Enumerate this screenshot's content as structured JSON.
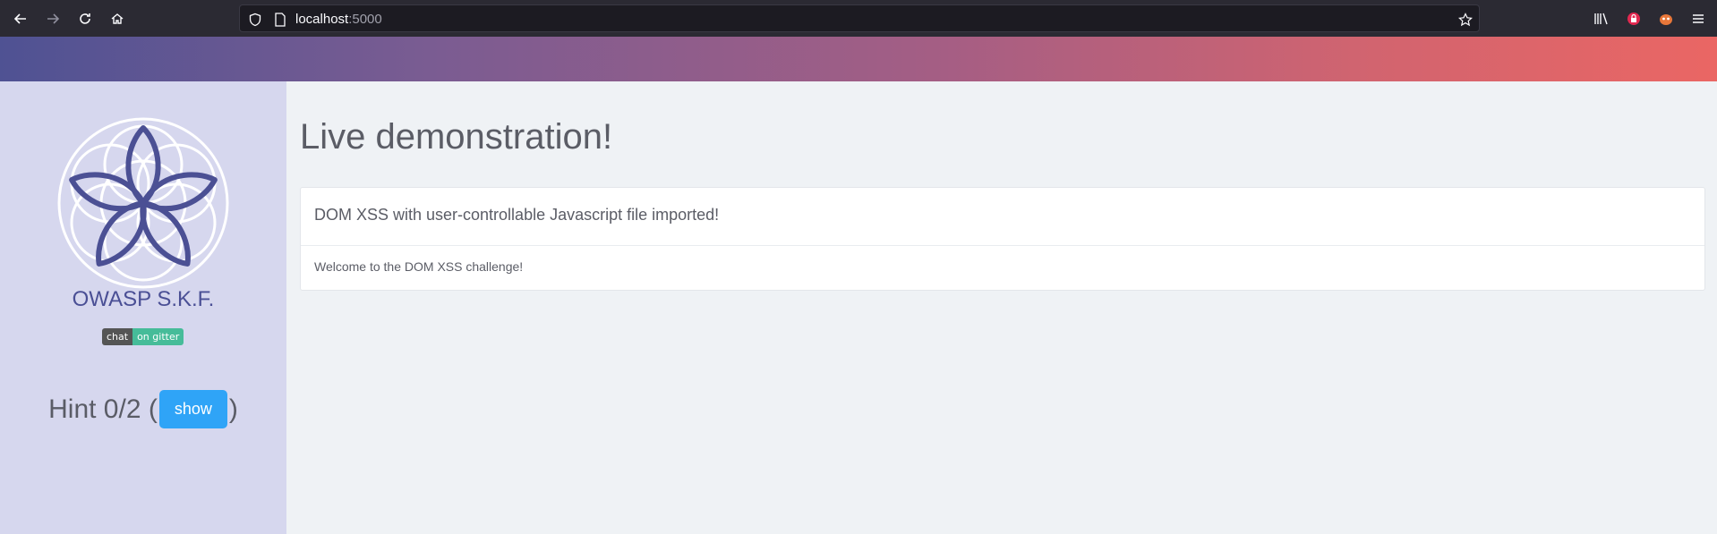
{
  "browser": {
    "url_host": "localhost",
    "url_port": ":5000"
  },
  "sidebar": {
    "brand": "OWASP S.K.F.",
    "badge_left": "chat",
    "badge_right": "on gitter",
    "hint_prefix": "Hint 0/2 (",
    "hint_suffix": ")",
    "show_label": "show"
  },
  "main": {
    "title": "Live demonstration!",
    "card_header": "DOM XSS with user-controllable Javascript file imported!",
    "card_body": "Welcome to the DOM XSS challenge!"
  },
  "colors": {
    "accent": "#2fa4f7",
    "brand": "#4a4f95",
    "sidebar_bg": "#d6d7ee"
  }
}
